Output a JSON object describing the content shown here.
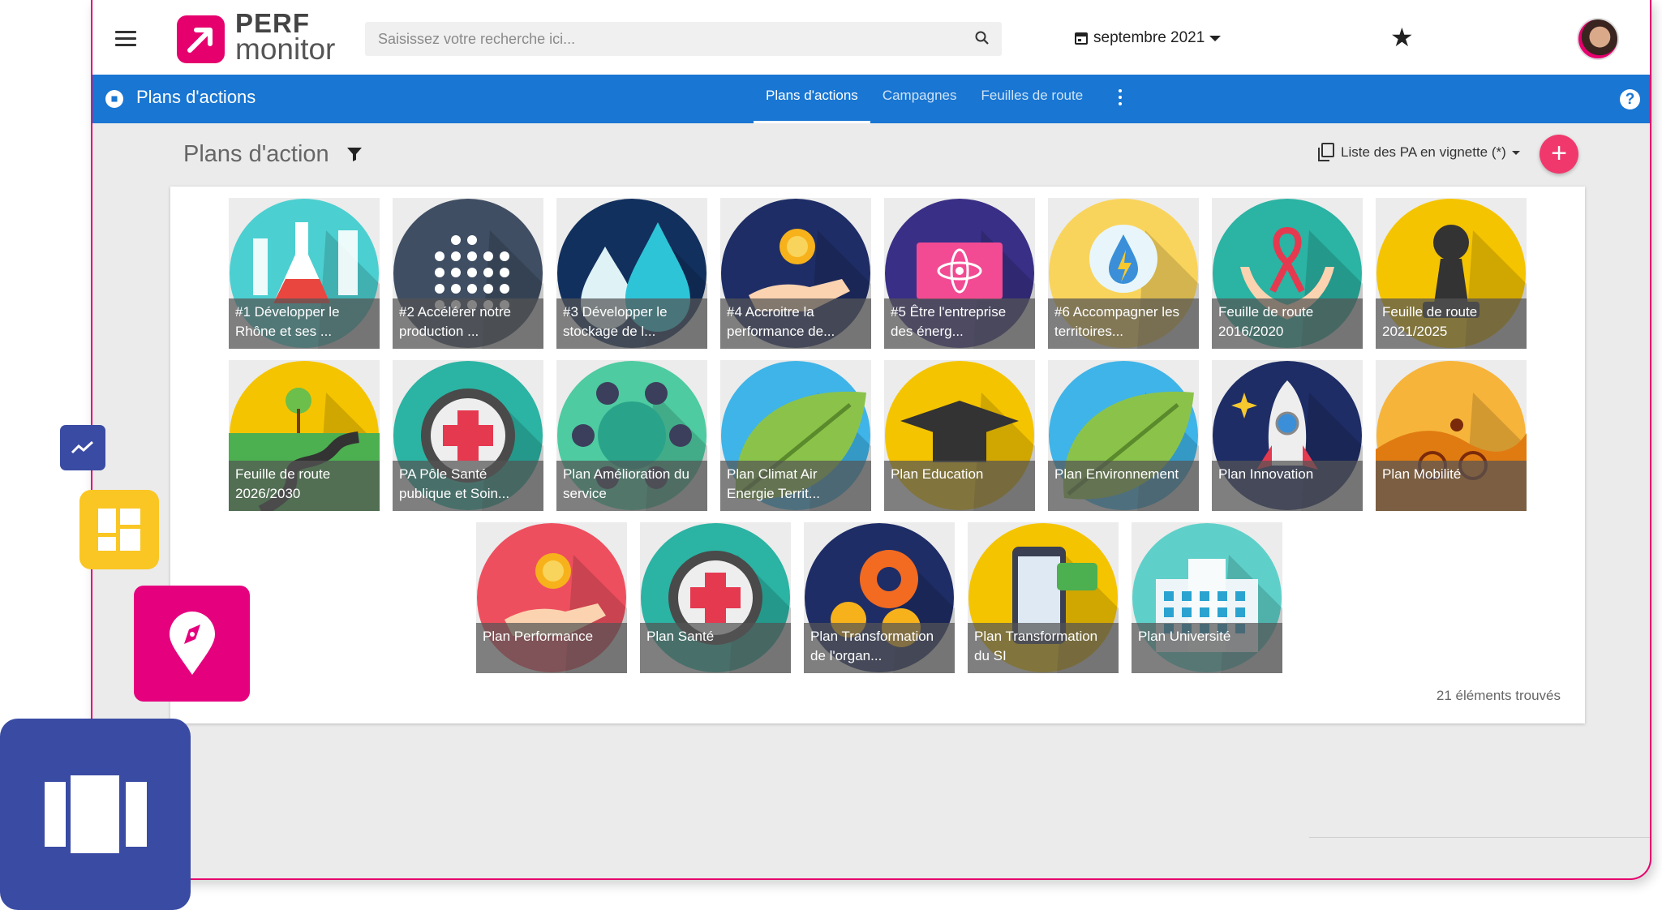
{
  "app": {
    "logo_line1": "PERF",
    "logo_line2": "monitor",
    "brand_color": "#e5006d",
    "nav_color": "#1976d2"
  },
  "header": {
    "search_placeholder": "Saisissez votre recherche ici...",
    "date_label": "septembre 2021",
    "favorite_icon": "star-icon",
    "menu_icon": "hamburger-icon",
    "search_icon": "search-icon",
    "date_icon": "calendar-icon"
  },
  "navbar": {
    "section_title": "Plans d'actions",
    "section_icon": "compass-icon",
    "tabs": [
      {
        "label": "Plans d'actions",
        "active": true
      },
      {
        "label": "Campagnes",
        "active": false
      },
      {
        "label": "Feuilles de route",
        "active": false
      }
    ],
    "more_icon": "more-vert-icon",
    "help_glyph": "?"
  },
  "content": {
    "heading": "Plans d'action",
    "filter_icon": "filter-icon",
    "view_label": "Liste des PA en vignette (*)",
    "view_icon": "copy-icon",
    "add_glyph": "+",
    "add_color": "#f0386c",
    "count_text": "21 éléments trouvés"
  },
  "tiles": [
    {
      "label": "#1 Développer le Rhône et ses ...",
      "icon": "lab-flasks-icon",
      "color": "#4ccfd0"
    },
    {
      "label": "#2 Accélérer notre production ...",
      "icon": "dots-grid-icon",
      "color": "#3f4e63"
    },
    {
      "label": "#3 Développer le stockage de l...",
      "icon": "water-drops-icon",
      "color": "#12305e"
    },
    {
      "label": "#4 Accroitre la performance de...",
      "icon": "coins-hand-icon",
      "color": "#1e2d66"
    },
    {
      "label": "#5 Être l'entreprise des énerg...",
      "icon": "atom-screen-icon",
      "color": "#3a2f86"
    },
    {
      "label": "#6 Accompagner les territoires...",
      "icon": "energy-bulb-icon",
      "color": "#f9d45c"
    },
    {
      "label": "Feuille de route 2016/2020",
      "icon": "ribbon-hands-icon",
      "color": "#2bb3a3"
    },
    {
      "label": "Feuille de route 2021/2025",
      "icon": "chess-pawn-icon",
      "color": "#f5c400"
    },
    {
      "label": "Feuille de route 2026/2030",
      "icon": "winding-road-icon",
      "color": "#f5c400"
    },
    {
      "label": "PA Pôle Santé publique et Soin...",
      "icon": "medical-cross-icon",
      "color": "#2bb3a3"
    },
    {
      "label": "Plan Amélioration du service",
      "icon": "teamwork-icon",
      "color": "#4ecba0"
    },
    {
      "label": "Plan Climat Air Energie Territ...",
      "icon": "leaf-icon",
      "color": "#3fb4e8"
    },
    {
      "label": "Plan Education",
      "icon": "graduation-cap-icon",
      "color": "#f5c400"
    },
    {
      "label": "Plan Environnement",
      "icon": "leaf-icon",
      "color": "#3fb4e8"
    },
    {
      "label": "Plan Innovation",
      "icon": "rocket-icon",
      "color": "#1e2d66"
    },
    {
      "label": "Plan Mobilité",
      "icon": "cyclist-icon",
      "color": "#f7b43a"
    },
    {
      "label": "Plan Performance",
      "icon": "coin-hand-icon",
      "color": "#ee4f5f"
    },
    {
      "label": "Plan Santé",
      "icon": "medical-cross-icon",
      "color": "#2bb3a3"
    },
    {
      "label": "Plan Transformation de l'organ...",
      "icon": "gears-icon",
      "color": "#1e2d66"
    },
    {
      "label": "Plan Transformation du SI",
      "icon": "smartphone-chat-icon",
      "color": "#f5c400"
    },
    {
      "label": "Plan Université",
      "icon": "university-building-icon",
      "color": "#5fd0c9"
    }
  ],
  "side_shortcuts": [
    {
      "name": "trend-chart-icon",
      "color": "#3a4ba3"
    },
    {
      "name": "dashboard-icon",
      "color": "#f9c623"
    },
    {
      "name": "location-compass-icon",
      "color": "#e5007e"
    },
    {
      "name": "kanban-board-icon",
      "color": "#3a4ba3"
    }
  ]
}
